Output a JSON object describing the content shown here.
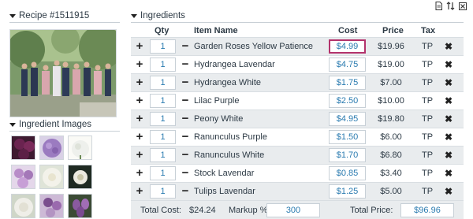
{
  "recipe": {
    "title": "Recipe #1511915"
  },
  "images_section": {
    "title": "Ingredient Images"
  },
  "ingredients_section": {
    "title": "Ingredients",
    "columns": {
      "qty": "Qty",
      "item": "Item Name",
      "cost": "Cost",
      "price": "Price",
      "tax": "Tax"
    },
    "rows": [
      {
        "qty": "1",
        "name": "Garden Roses Yellow Patience",
        "cost": "$4.99",
        "price": "$19.96",
        "tax": "TP"
      },
      {
        "qty": "1",
        "name": "Hydrangea Lavendar",
        "cost": "$4.75",
        "price": "$19.00",
        "tax": "TP"
      },
      {
        "qty": "1",
        "name": "Hydrangea White",
        "cost": "$1.75",
        "price": "$7.00",
        "tax": "TP"
      },
      {
        "qty": "1",
        "name": "Lilac Purple",
        "cost": "$2.50",
        "price": "$10.00",
        "tax": "TP"
      },
      {
        "qty": "1",
        "name": "Peony White",
        "cost": "$4.95",
        "price": "$19.80",
        "tax": "TP"
      },
      {
        "qty": "1",
        "name": "Ranunculus Purple",
        "cost": "$1.50",
        "price": "$6.00",
        "tax": "TP"
      },
      {
        "qty": "1",
        "name": "Ranunculus White",
        "cost": "$1.70",
        "price": "$6.80",
        "tax": "TP"
      },
      {
        "qty": "1",
        "name": "Stock Lavendar",
        "cost": "$0.85",
        "price": "$3.40",
        "tax": "TP"
      },
      {
        "qty": "1",
        "name": "Tulips Lavendar",
        "cost": "$1.25",
        "price": "$5.00",
        "tax": "TP"
      }
    ],
    "symbols": {
      "plus": "+",
      "minus": "−",
      "delete": "✖"
    }
  },
  "totals": {
    "total_cost_label": "Total Cost:",
    "total_cost": "$24.24",
    "markup_label": "Markup %",
    "markup": "300",
    "total_price_label": "Total Price:",
    "total_price": "$96.96"
  },
  "colors": {
    "accent": "#2a7bb0",
    "highlight": "#b3336c",
    "row_alt": "#e9ecee"
  },
  "thumbnails": [
    {
      "icon": "dark-purple-flowers",
      "color": "#5b2046"
    },
    {
      "icon": "lavender-hydrangea",
      "color": "#9b7bc0"
    },
    {
      "icon": "white-hydrangea",
      "color": "#eef0ec"
    },
    {
      "icon": "lilac-purple",
      "color": "#b88cc8"
    },
    {
      "icon": "white-peony",
      "color": "#f3f2ea"
    },
    {
      "icon": "dark-foliage",
      "color": "#1f2a22"
    },
    {
      "icon": "white-ranunculus",
      "color": "#efeee8"
    },
    {
      "icon": "purple-stock",
      "color": "#7a4e8e"
    },
    {
      "icon": "lavender-tulips",
      "color": "#8a5aa0"
    }
  ]
}
